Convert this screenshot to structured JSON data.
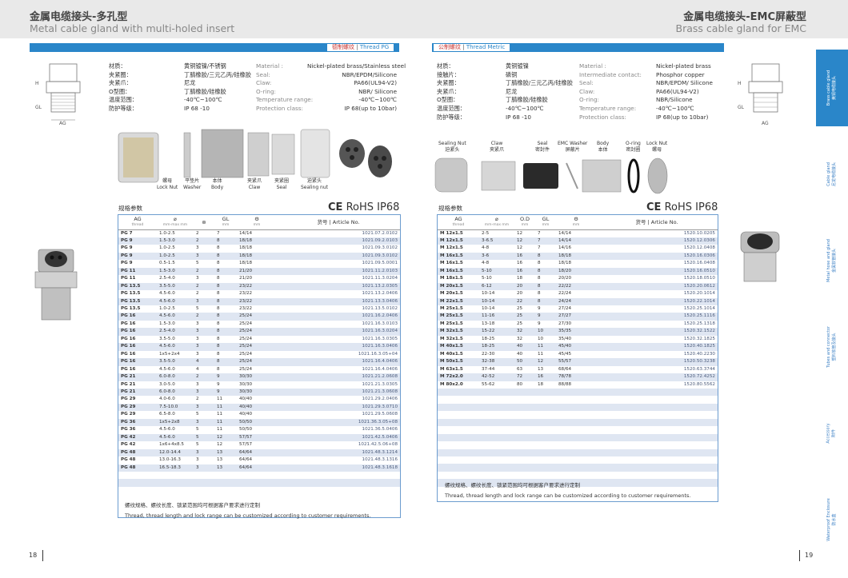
{
  "header": {
    "left_cn": "金属电缆接头-多孔型",
    "left_en": "Metal cable gland with multi-holed insert",
    "right_cn": "金属电缆接头-EMC屏蔽型",
    "right_en": "Brass cable gland for EMC"
  },
  "left": {
    "thread_tag_cn": "德制螺纹",
    "thread_tag_en": "Thread PG",
    "specs": [
      {
        "cn": "材质：",
        "cn_val": "黄铜镀镍/不锈钢",
        "en": "Material :",
        "en_val": "Nickel-plated brass/Stainless steel"
      },
      {
        "cn": "夹紧圈：",
        "cn_val": "丁腈橡胶/三元乙丙/硅橡胶",
        "en": "Seal:",
        "en_val": "NBR/EPDM/Silicone"
      },
      {
        "cn": "夹紧爪：",
        "cn_val": "尼龙",
        "en": "Claw:",
        "en_val": "PA66(UL94-V2)"
      },
      {
        "cn": "O型圈：",
        "cn_val": "丁腈橡胶/硅橡胶",
        "en": "O-ring:",
        "en_val": "NBR/ Silicone"
      },
      {
        "cn": "温度范围：",
        "cn_val": "-40℃~100℃",
        "en": "Temperature range:",
        "en_val": "-40℃~100℃"
      },
      {
        "cn": "防护等级：",
        "cn_val": "IP 68 -10",
        "en": "Protection class:",
        "en_val": "IP 68(up to 10bar)"
      }
    ],
    "parts": [
      {
        "cn": "螺母",
        "en": "Lock Nut"
      },
      {
        "cn": "平垫片",
        "en": "Washer"
      },
      {
        "cn": "本体",
        "en": "Body"
      },
      {
        "cn": "夹紧爪",
        "en": "Claw"
      },
      {
        "cn": "夹紧圈",
        "en": "Seal"
      },
      {
        "cn": "迫紧头",
        "en": "Sealing nut"
      }
    ],
    "section_title": "规格参数",
    "ce": "CE",
    "rohs": "RoHS",
    "ip": "IP68",
    "col_headers": {
      "ag": "AG",
      "ag_sub": "thread",
      "range": "mm-max mm",
      "holes": "⊛",
      "gl": "GL",
      "gl_sub": "mm",
      "wrench": "mm",
      "article": "货号 | Article No."
    },
    "rows": [
      [
        "PG 7",
        "1.0-2.5",
        "2",
        "7",
        "14/14",
        "1021.07.2.0102"
      ],
      [
        "PG 9",
        "1.5-3.0",
        "2",
        "8",
        "18/18",
        "1021.09.2.0103"
      ],
      [
        "PG 9",
        "1.0-2.5",
        "3",
        "8",
        "18/18",
        "1021.09.3.0102"
      ],
      [
        "PG 9",
        "1.0-2.5",
        "3",
        "8",
        "18/18",
        "1021.09.3.0102"
      ],
      [
        "PG 9",
        "0.5-1.5",
        "5",
        "8",
        "18/18",
        "1021.09.5.0001"
      ],
      [
        "PG 11",
        "1.5-3.0",
        "2",
        "8",
        "21/20",
        "1021.11.2.0103"
      ],
      [
        "PG 11",
        "2.5-4.0",
        "3",
        "8",
        "21/20",
        "1021.11.3.0204"
      ],
      [
        "PG 13.5",
        "3.5-5.0",
        "2",
        "8",
        "23/22",
        "1021.13.2.0305"
      ],
      [
        "PG 13.5",
        "4.5-6.0",
        "2",
        "8",
        "23/22",
        "1021.13.2.0406"
      ],
      [
        "PG 13.5",
        "4.5-6.0",
        "3",
        "8",
        "23/22",
        "1021.13.3.0406"
      ],
      [
        "PG 13.5",
        "1.0-2.5",
        "5",
        "8",
        "23/22",
        "1021.13.5.0102"
      ],
      [
        "PG 16",
        "4.5-6.0",
        "2",
        "8",
        "25/24",
        "1021.16.2.0406"
      ],
      [
        "PG 16",
        "1.5-3.0",
        "3",
        "8",
        "25/24",
        "1021.16.3.0103"
      ],
      [
        "PG 16",
        "2.5-4.0",
        "3",
        "8",
        "25/24",
        "1021.16.3.0204"
      ],
      [
        "PG 16",
        "3.5-5.0",
        "3",
        "8",
        "25/24",
        "1021.16.3.0305"
      ],
      [
        "PG 16",
        "4.5-6.0",
        "3",
        "8",
        "25/24",
        "1021.16.3.0406"
      ],
      [
        "PG 16",
        "1x5+2x4",
        "3",
        "8",
        "25/24",
        "1021.16.3.05+04"
      ],
      [
        "PG 16",
        "3.5-5.0",
        "4",
        "8",
        "25/24",
        "1021.16.4.0406"
      ],
      [
        "PG 16",
        "4.5-6.0",
        "4",
        "8",
        "25/24",
        "1021.16.4.0406"
      ],
      [
        "PG 21",
        "6.0-8.0",
        "2",
        "9",
        "30/30",
        "1021.21.2.0608"
      ],
      [
        "PG 21",
        "3.0-5.0",
        "3",
        "9",
        "30/30",
        "1021.21.3.0305"
      ],
      [
        "PG 21",
        "6.0-8.0",
        "3",
        "9",
        "30/30",
        "1021.21.3.0608"
      ],
      [
        "PG 29",
        "4.0-6.0",
        "2",
        "11",
        "40/40",
        "1021.29.2.0406"
      ],
      [
        "PG 29",
        "7.5-10.0",
        "3",
        "11",
        "40/40",
        "1021.29.3.0710"
      ],
      [
        "PG 29",
        "6.5-8.0",
        "5",
        "11",
        "40/40",
        "1021.29.5.0608"
      ],
      [
        "PG 36",
        "1x5+2x8",
        "3",
        "11",
        "50/50",
        "1021.36.3.05+08"
      ],
      [
        "PG 36",
        "4.5-6.0",
        "5",
        "11",
        "50/50",
        "1021.36.5.0406"
      ],
      [
        "PG 42",
        "4.5-6.0",
        "5",
        "12",
        "57/57",
        "1021.42.5.0406"
      ],
      [
        "PG 42",
        "1x6+4x8.5",
        "5",
        "12",
        "57/57",
        "1021.42.5.06+08"
      ],
      [
        "PG 48",
        "12.0-14.4",
        "3",
        "13",
        "64/64",
        "1021.48.3.1214"
      ],
      [
        "PG 48",
        "13.0-16.3",
        "3",
        "13",
        "64/64",
        "1021.48.3.1316"
      ],
      [
        "PG 48",
        "16.5-18.3",
        "3",
        "13",
        "64/64",
        "1021.48.3.1618"
      ]
    ],
    "note_cn": "螺纹规格、螺纹长度、锁紧范围均可根据客户要求进行定制",
    "note_en": "Thread, thread length and lock range can be customized according to customer requirements.",
    "page": "18"
  },
  "right": {
    "thread_tag_cn": "公制螺纹",
    "thread_tag_en": "Thread Metric",
    "specs": [
      {
        "cn": "材质：",
        "cn_val": "黄铜镀镍",
        "en": "Material :",
        "en_val": "Nickel-plated brass"
      },
      {
        "cn": "接触片：",
        "cn_val": "磷铜",
        "en": "Intermediate contact:",
        "en_val": "Phosphor copper"
      },
      {
        "cn": "夹紧圈：",
        "cn_val": "丁腈橡胶/三元乙丙/硅橡胶",
        "en": "Seal:",
        "en_val": "NBR/EPDM/ Silicone"
      },
      {
        "cn": "夹紧爪：",
        "cn_val": "尼龙",
        "en": "Claw:",
        "en_val": "PA66(UL94-V2)"
      },
      {
        "cn": "O型圈：",
        "cn_val": "丁腈橡胶/硅橡胶",
        "en": "O-ring:",
        "en_val": "NBR/Silicone"
      },
      {
        "cn": "温度范围：",
        "cn_val": "-40℃~100℃",
        "en": "Temperature range:",
        "en_val": "-40℃~100℃"
      },
      {
        "cn": "防护等级：",
        "cn_val": "IP 68 -10",
        "en": "Protection class:",
        "en_val": "IP 68(up to 10bar)"
      }
    ],
    "parts": [
      {
        "en": "Sealing Nut",
        "cn": "迫紧头"
      },
      {
        "en": "Claw",
        "cn": "夹紧爪"
      },
      {
        "en": "Seal",
        "cn": "密封件"
      },
      {
        "en": "EMC Washer",
        "cn": "屏蔽片"
      },
      {
        "en": "Body",
        "cn": "本体"
      },
      {
        "en": "O-ring",
        "cn": "密封圈"
      },
      {
        "en": "Lock Nut",
        "cn": "螺母"
      }
    ],
    "section_title": "规格参数",
    "ce": "CE",
    "rohs": "RoHS",
    "ip": "IP68",
    "col_headers": {
      "ag": "AG",
      "ag_sub": "thread",
      "range": "mm-max mm",
      "od": "O.D",
      "od_sub": "mm",
      "gl": "GL",
      "gl_sub": "mm",
      "wrench": "mm",
      "article": "货号 | Article No."
    },
    "rows": [
      [
        "M 12x1.5",
        "2-5",
        "12",
        "7",
        "14/14",
        "1520.10.0205"
      ],
      [
        "M 12x1.5",
        "3-6.5",
        "12",
        "7",
        "14/14",
        "1520.12.0306"
      ],
      [
        "M 12x1.5",
        "4-8",
        "12",
        "7",
        "14/16",
        "1520.12.0408"
      ],
      [
        "M 16x1.5",
        "3-6",
        "16",
        "8",
        "18/18",
        "1520.16.0306"
      ],
      [
        "M 16x1.5",
        "4-8",
        "16",
        "8",
        "18/18",
        "1520.16.0408"
      ],
      [
        "M 16x1.5",
        "5-10",
        "16",
        "8",
        "18/20",
        "1520.16.0510"
      ],
      [
        "M 18x1.5",
        "5-10",
        "18",
        "8",
        "20/20",
        "1520.18.0510"
      ],
      [
        "M 20x1.5",
        "6-12",
        "20",
        "8",
        "22/22",
        "1520.20.0612"
      ],
      [
        "M 20x1.5",
        "10-14",
        "20",
        "8",
        "22/24",
        "1520.20.1014"
      ],
      [
        "M 22x1.5",
        "10-14",
        "22",
        "8",
        "24/24",
        "1520.22.1014"
      ],
      [
        "M 25x1.5",
        "10-14",
        "25",
        "9",
        "27/24",
        "1520.25.1014"
      ],
      [
        "M 25x1.5",
        "11-16",
        "25",
        "9",
        "27/27",
        "1520.25.1116"
      ],
      [
        "M 25x1.5",
        "13-18",
        "25",
        "9",
        "27/30",
        "1520.25.1318"
      ],
      [
        "M 32x1.5",
        "15-22",
        "32",
        "10",
        "35/35",
        "1520.32.1522"
      ],
      [
        "M 32x1.5",
        "18-25",
        "32",
        "10",
        "35/40",
        "1520.32.1825"
      ],
      [
        "M 40x1.5",
        "18-25",
        "40",
        "11",
        "45/40",
        "1520.40.1825"
      ],
      [
        "M 40x1.5",
        "22-30",
        "40",
        "11",
        "45/45",
        "1520.40.2230"
      ],
      [
        "M 50x1.5",
        "32-38",
        "50",
        "12",
        "55/57",
        "1520.50.3238"
      ],
      [
        "M 63x1.5",
        "37-44",
        "63",
        "13",
        "68/64",
        "1520.63.3744"
      ],
      [
        "M 72x2.0",
        "42-52",
        "72",
        "16",
        "78/78",
        "1520.72.4252"
      ],
      [
        "M 80x2.0",
        "55-62",
        "80",
        "18",
        "88/88",
        "1520.80.5562"
      ]
    ],
    "note_cn": "螺纹规格、螺纹长度、锁紧范围均可根据客户要求进行定制",
    "note_en": "Thread, thread length and lock range can be customized according to customer requirements.",
    "page": "19"
  },
  "sidebar": [
    {
      "en": "Brass cable gland",
      "cn": "黄铜电缆接头"
    },
    {
      "en": "Cable gland",
      "cn": "尼龙电缆接头"
    },
    {
      "en": "Metal hose and gland",
      "cn": "金属软管接头"
    },
    {
      "en": "Tubes and connector",
      "cn": "塑料软管及接头"
    },
    {
      "en": "Accessory",
      "cn": "附件"
    },
    {
      "en": "Waterproof Enclosure",
      "cn": "防水盒"
    }
  ],
  "colors": {
    "accent": "#2a86c9",
    "red": "#c8322e",
    "row_alt": "#dfe6f2",
    "header_bg": "#e9e9e9"
  }
}
